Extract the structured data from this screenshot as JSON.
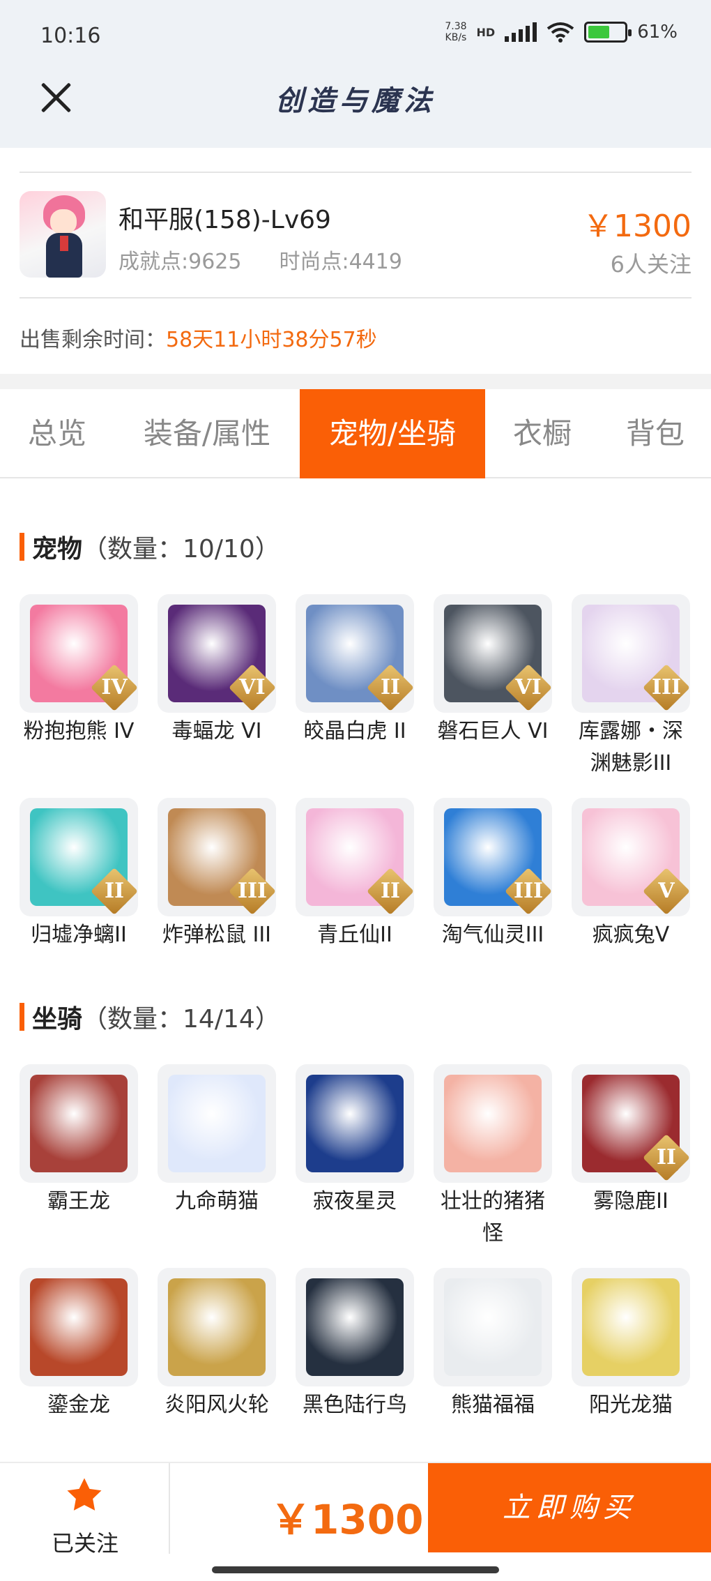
{
  "status_bar": {
    "time": "10:16",
    "net_speed_value": "7.38",
    "net_speed_unit": "KB/s",
    "network_type": "HD",
    "battery": "61",
    "battery_unit": "%"
  },
  "header": {
    "title": "创造与魔法",
    "close_icon": "close-icon"
  },
  "item": {
    "name": "和平服(158)-Lv69",
    "achievement": "成就点:9625",
    "fashion": "时尚点:4419",
    "price": "￥1300",
    "followers": "6人关注",
    "remaining_label": "出售剩余时间：",
    "remaining_value": "58天11小时38分57秒"
  },
  "tabs": [
    {
      "label": "总览",
      "active": false
    },
    {
      "label": "装备/属性",
      "active": false
    },
    {
      "label": "宠物/坐骑",
      "active": true
    },
    {
      "label": "衣橱",
      "active": false
    },
    {
      "label": "背包",
      "active": false
    }
  ],
  "pets": {
    "title": "宠物",
    "count": "（数量：10/10）",
    "items": [
      {
        "name": "粉抱抱熊 IV",
        "rank": "IV",
        "color": "#f37aa0"
      },
      {
        "name": "毒蝠龙 VI",
        "rank": "VI",
        "color": "#5a2b78"
      },
      {
        "name": "皎晶白虎 II",
        "rank": "II",
        "color": "#6f8fc4"
      },
      {
        "name": "磐石巨人 VI",
        "rank": "VI",
        "color": "#4d5560"
      },
      {
        "name": "库露娜・深渊魅影III",
        "rank": "III",
        "color": "#e4d4ee"
      },
      {
        "name": "归墟净螭II",
        "rank": "II",
        "color": "#3fc4c2"
      },
      {
        "name": "炸弹松鼠 III",
        "rank": "III",
        "color": "#c08a54"
      },
      {
        "name": "青丘仙II",
        "rank": "II",
        "color": "#f4b6d8"
      },
      {
        "name": "淘气仙灵III",
        "rank": "III",
        "color": "#2f7fd6"
      },
      {
        "name": "疯疯兔V",
        "rank": "V",
        "color": "#f7c2d6"
      }
    ]
  },
  "mounts": {
    "title": "坐骑",
    "count": "（数量：14/14）",
    "items": [
      {
        "name": "霸王龙",
        "rank": "",
        "color": "#a8413a"
      },
      {
        "name": "九命萌猫",
        "rank": "",
        "color": "#dfe8fb"
      },
      {
        "name": "寂夜星灵",
        "rank": "",
        "color": "#1d3d8c"
      },
      {
        "name": "壮壮的猪猪怪",
        "rank": "",
        "color": "#f4b2a4"
      },
      {
        "name": "雾隐鹿II",
        "rank": "II",
        "color": "#9b2b2f"
      },
      {
        "name": "鎏金龙",
        "rank": "",
        "color": "#b8482a"
      },
      {
        "name": "炎阳风火轮",
        "rank": "",
        "color": "#caa34a"
      },
      {
        "name": "黑色陆行鸟",
        "rank": "",
        "color": "#253040"
      },
      {
        "name": "熊猫福福",
        "rank": "",
        "color": "#e9ecef"
      },
      {
        "name": "阳光龙猫",
        "rank": "",
        "color": "#e6d064"
      }
    ]
  },
  "bottom_bar": {
    "star_icon": "star-icon",
    "follow_label": "已关注",
    "price": "￥1300",
    "buy_label": "立即购买"
  },
  "colors": {
    "accent": "#fa5f06",
    "price": "#f36a10",
    "header_bg": "#eef2f6"
  }
}
